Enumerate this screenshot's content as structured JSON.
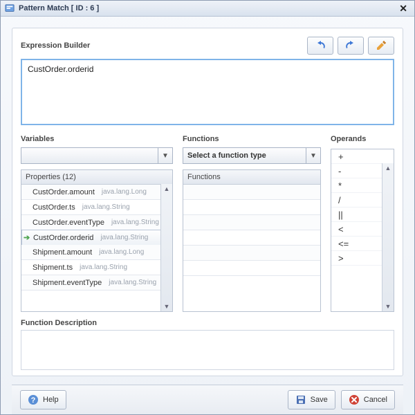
{
  "window": {
    "title": "Pattern Match [ ID : 6 ]"
  },
  "expression": {
    "label": "Expression Builder",
    "value": "CustOrder.orderid"
  },
  "toolbar": {
    "undo": "undo",
    "redo": "redo",
    "edit": "edit"
  },
  "variables": {
    "label": "Variables",
    "dropdown_value": "",
    "properties_header": "Properties (12)",
    "items": [
      {
        "name": "CustOrder.amount",
        "type": "java.lang.Long",
        "selected": false
      },
      {
        "name": "CustOrder.ts",
        "type": "java.lang.String",
        "selected": false
      },
      {
        "name": "CustOrder.eventType",
        "type": "java.lang.String",
        "selected": false
      },
      {
        "name": "CustOrder.orderid",
        "type": "java.lang.String",
        "selected": true
      },
      {
        "name": "Shipment.amount",
        "type": "java.lang.Long",
        "selected": false
      },
      {
        "name": "Shipment.ts",
        "type": "java.lang.String",
        "selected": false
      },
      {
        "name": "Shipment.eventType",
        "type": "java.lang.String",
        "selected": false
      }
    ]
  },
  "functions": {
    "label": "Functions",
    "dropdown_value": "Select a function type",
    "header": "Functions",
    "rows": [
      "",
      "",
      "",
      "",
      "",
      ""
    ]
  },
  "operands": {
    "label": "Operands",
    "items": [
      "+",
      "-",
      "*",
      "/",
      "||",
      "<",
      "<=",
      ">"
    ]
  },
  "function_description": {
    "label": "Function Description",
    "value": ""
  },
  "footer": {
    "help": "Help",
    "save": "Save",
    "cancel": "Cancel"
  },
  "colors": {
    "accent": "#7fb4e8",
    "danger": "#d04437",
    "save": "#3b5ea0",
    "help": "#3b6fb0"
  }
}
